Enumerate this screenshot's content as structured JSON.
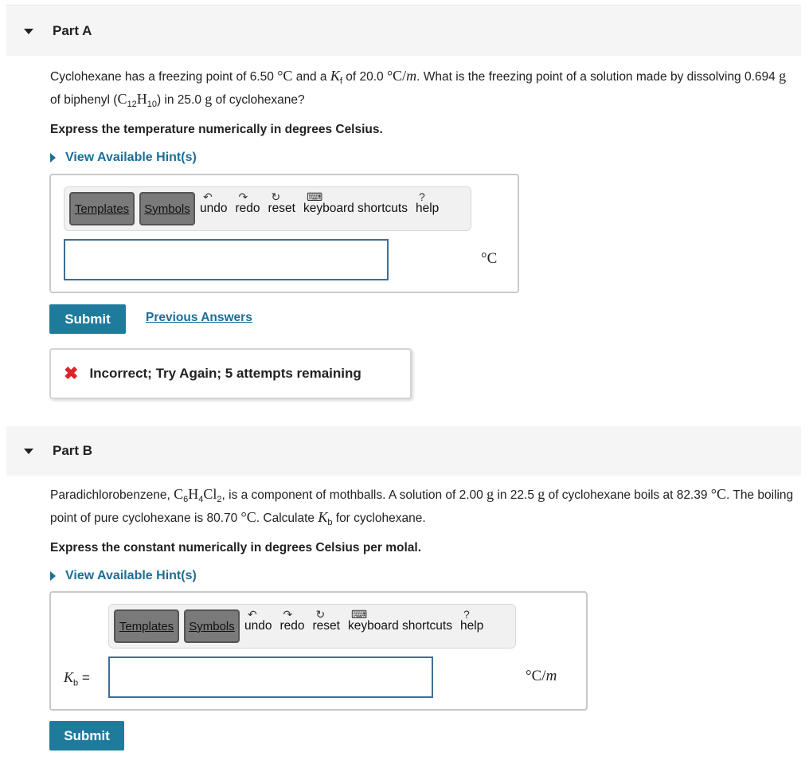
{
  "partA": {
    "title": "Part A",
    "question": {
      "t1": "Cyclohexane has a freezing point of 6.50 ",
      "degC": "°C",
      "t2": " and a ",
      "kf_sym": "K",
      "kf_sub": "f",
      "t3": " of 20.0 ",
      "kf_unit": "°C/",
      "m": "m",
      "t4": ". What is the freezing point of a solution made by dissolving 0.694 ",
      "g1": "g",
      "t5": " of biphenyl (",
      "f_c": "C",
      "f_csub": "12",
      "f_h": "H",
      "f_hsub": "10",
      "t6": ") in 25.0 ",
      "g2": "g",
      "t7": " of cyclohexane?"
    },
    "instruction": "Express the temperature numerically in degrees Celsius.",
    "hint_label": "View Available Hint(s)",
    "toolbar": {
      "templates": "Templates",
      "symbols": "Symbols",
      "undo": "undo",
      "redo": "redo",
      "reset": "reset",
      "shortcuts": "keyboard shortcuts",
      "help": "help"
    },
    "input_value": "",
    "unit": "°C",
    "submit": "Submit",
    "previous": "Previous Answers",
    "feedback": "Incorrect; Try Again; 5 attempts remaining"
  },
  "partB": {
    "title": "Part B",
    "question": {
      "t1": "Paradichlorobenzene, ",
      "c": "C",
      "c_sub": "6",
      "h": "H",
      "h_sub": "4",
      "cl": "Cl",
      "cl_sub": "2",
      "t2": ", is a component of mothballs. A solution of 2.00 ",
      "g1": "g",
      "t3": " in 22.5 ",
      "g2": "g",
      "t4": " of cyclohexane boils at 82.39 ",
      "degC1": "°C",
      "t5": ". The boiling point of pure cyclohexane is 80.70 ",
      "degC2": "°C",
      "t6": ". Calculate ",
      "kb_sym": "K",
      "kb_sub": "b",
      "t7": " for cyclohexane."
    },
    "instruction": "Express the constant numerically in degrees Celsius per molal.",
    "hint_label": "View Available Hint(s)",
    "toolbar": {
      "templates": "Templates",
      "symbols": "Symbols",
      "undo": "undo",
      "redo": "redo",
      "reset": "reset",
      "shortcuts": "keyboard shortcuts",
      "help": "help"
    },
    "var_sym": "K",
    "var_sub": "b",
    "var_eq": "=",
    "input_value": "",
    "unit_main": "°C/",
    "unit_m": "m",
    "submit": "Submit"
  },
  "colors": {
    "accent": "#1e7b9c",
    "link": "#1b6f98",
    "error": "#d8262a"
  }
}
